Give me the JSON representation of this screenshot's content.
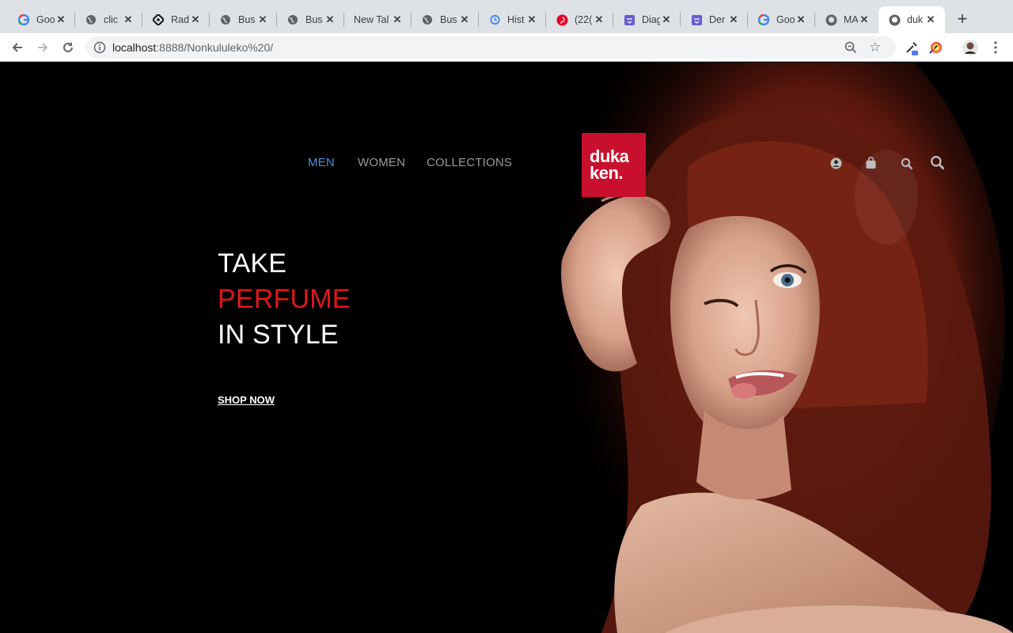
{
  "browser": {
    "tabs": [
      {
        "title": "Goo",
        "icon": "google-icon"
      },
      {
        "title": "clic",
        "icon": "globe-icon"
      },
      {
        "title": "Rad",
        "icon": "radix-icon"
      },
      {
        "title": "Bus",
        "icon": "globe-icon"
      },
      {
        "title": "Bus",
        "icon": "globe-icon"
      },
      {
        "title": "New Tal",
        "icon": ""
      },
      {
        "title": "Bus",
        "icon": "globe-icon"
      },
      {
        "title": "Hist",
        "icon": "history-icon"
      },
      {
        "title": "(22(",
        "icon": "pinterest-icon"
      },
      {
        "title": "Diag",
        "icon": "diagram-icon"
      },
      {
        "title": "Der",
        "icon": "diagram-icon"
      },
      {
        "title": "Goo",
        "icon": "google-icon"
      },
      {
        "title": "MA",
        "icon": "github-icon"
      },
      {
        "title": "duk",
        "icon": "github-icon",
        "active": true
      }
    ],
    "url_host": "localhost",
    "url_rest": ":8888/Nonkululeko%20/"
  },
  "nav": {
    "items": [
      "MEN",
      "WOMEN",
      "COLLECTIONS"
    ],
    "active": "MEN"
  },
  "logo": {
    "line1": "duka",
    "line2": "ken."
  },
  "hero": {
    "line1": "TAKE",
    "line2": "PERFUME",
    "line3": "IN STYLE",
    "cta": "SHOP NOW"
  },
  "colors": {
    "accent_red": "#e0161d",
    "logo_bg": "#c8102e",
    "nav_active": "#4a90d9",
    "nav_text": "#9a9a9a"
  }
}
